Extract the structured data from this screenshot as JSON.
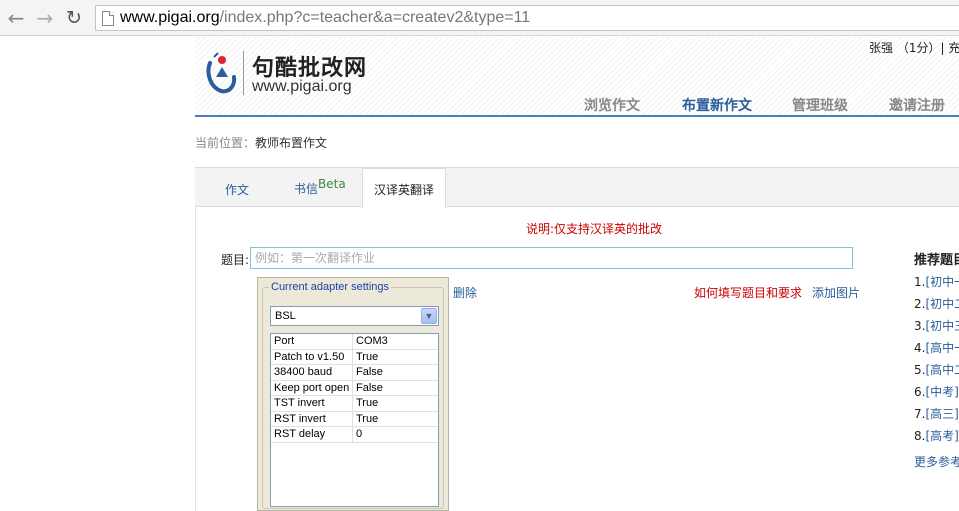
{
  "browser": {
    "url_host": "www.pigai.org",
    "url_rest": "/index.php?c=teacher&a=createv2&type=11"
  },
  "site": {
    "name": "句酷批改网",
    "domain": "www.pigai.org",
    "user": "张强 （1分）| 充"
  },
  "nav": [
    "浏览作文",
    "布置新作文",
    "管理班级",
    "邀请注册"
  ],
  "breadcrumb": {
    "label": "当前位置：",
    "current": "教师布置作文"
  },
  "tabs": {
    "essay": "作文",
    "letter": "书信",
    "letter_badge": "Beta",
    "translate": "汉译英翻译"
  },
  "form": {
    "note": "说明:仅支持汉译英的批改",
    "subject_label": "题目:",
    "subject_placeholder": "例如：第一次翻译作业",
    "delete_link": "删除",
    "howto_link": "如何填写题目和要求",
    "add_image_link": "添加图片"
  },
  "adapter": {
    "title": "Current adapter settings",
    "selected": "BSL",
    "rows": [
      {
        "k": "Port",
        "v": "COM3"
      },
      {
        "k": "Patch to v1.50",
        "v": "True"
      },
      {
        "k": "38400 baud",
        "v": "False"
      },
      {
        "k": "Keep port open",
        "v": "False"
      },
      {
        "k": "TST invert",
        "v": "True"
      },
      {
        "k": "RST invert",
        "v": "True"
      },
      {
        "k": "RST delay",
        "v": "0"
      }
    ]
  },
  "sidebar": {
    "title": "推荐题目",
    "items": [
      {
        "num": "1.",
        "text": "[初中一"
      },
      {
        "num": "2.",
        "text": "[初中二"
      },
      {
        "num": "3.",
        "text": "[初中三"
      },
      {
        "num": "4.",
        "text": "[高中一"
      },
      {
        "num": "5.",
        "text": "[高中二"
      },
      {
        "num": "6.",
        "text": "[中考]"
      },
      {
        "num": "7.",
        "text": "[高三]"
      },
      {
        "num": "8.",
        "text": "[高考]"
      }
    ],
    "more": "更多参考"
  },
  "colors": {
    "accent": "#2a5d9c",
    "warning": "#cc0000",
    "header_rule": "#4a7fbf"
  }
}
